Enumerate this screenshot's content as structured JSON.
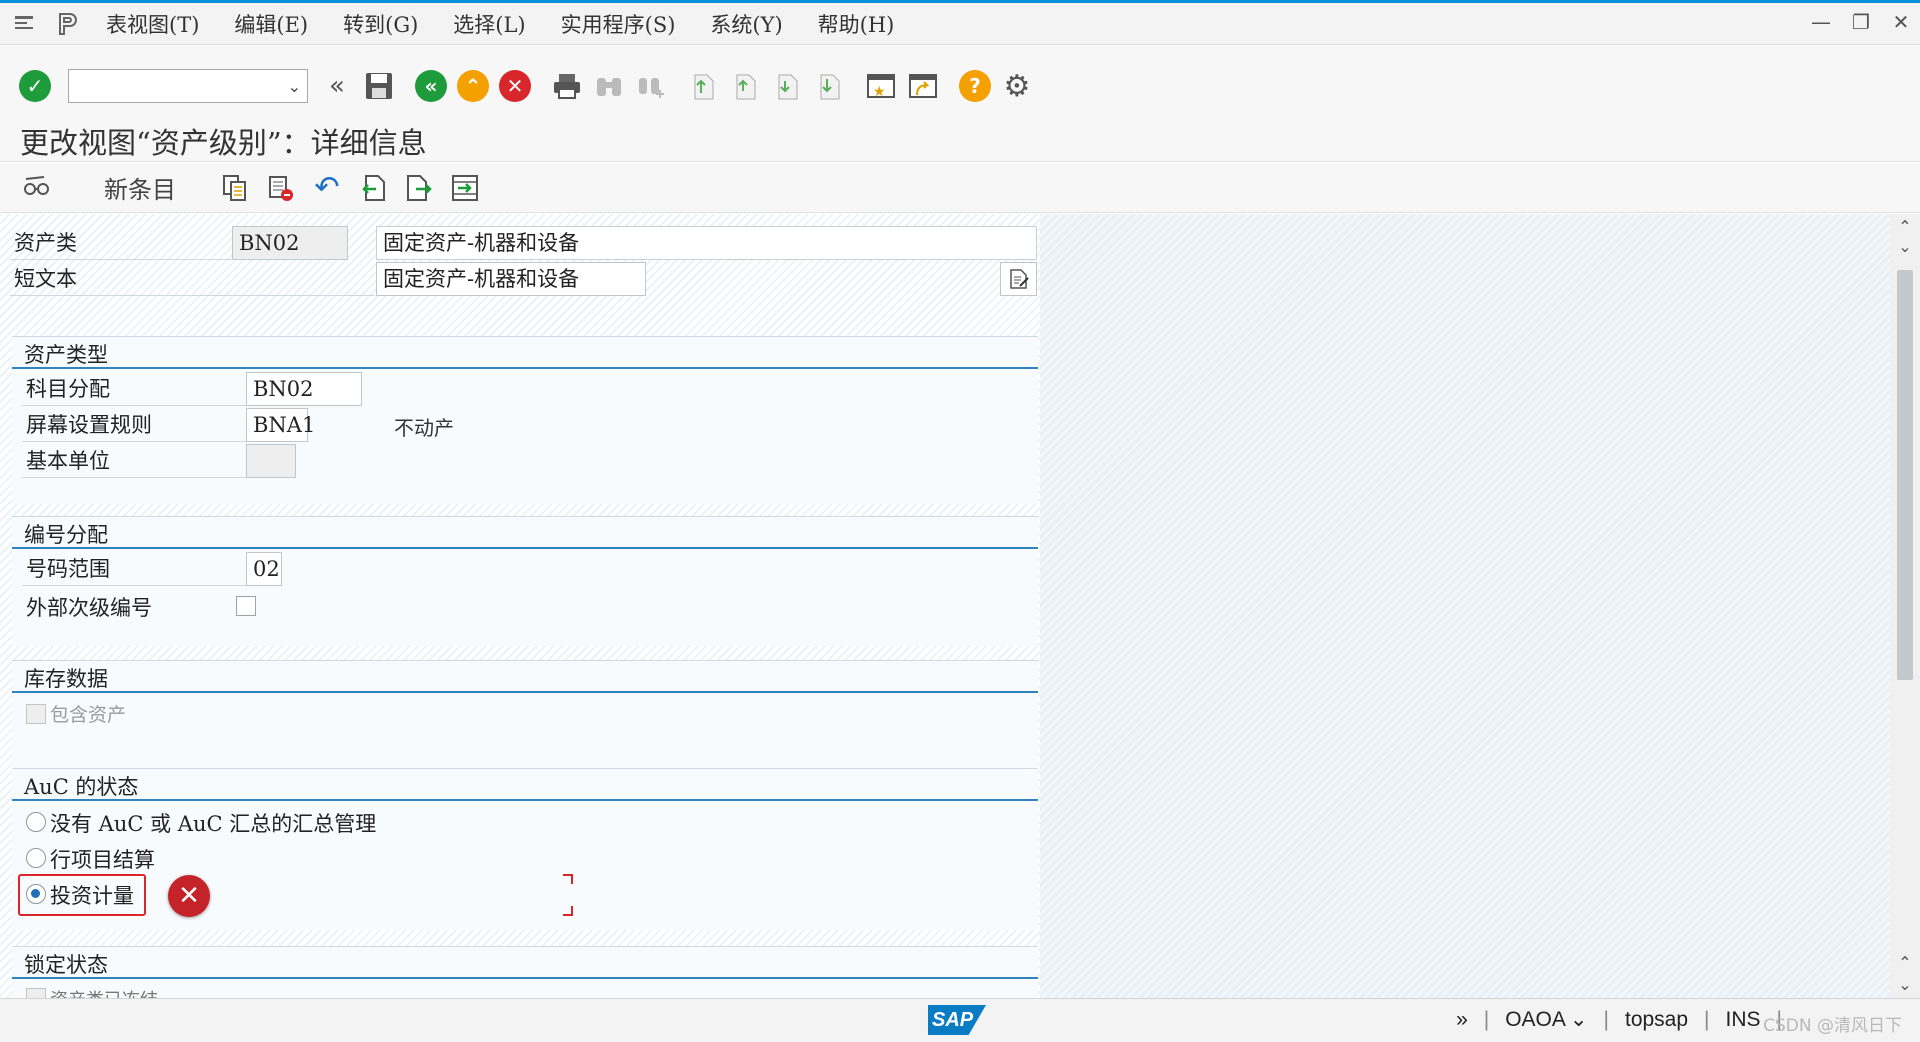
{
  "menu": {
    "items": [
      "表视图(T)",
      "编辑(E)",
      "转到(G)",
      "选择(L)",
      "实用程序(S)",
      "系统(Y)",
      "帮助(H)"
    ]
  },
  "toolbar": {
    "command_value": ""
  },
  "title": "更改视图“资产级别”：详细信息",
  "app_toolbar": {
    "new_entries_label": "新条目"
  },
  "header_fields": {
    "asset_class_label": "资产类",
    "asset_class_value": "BN02",
    "asset_class_desc": "固定资产-机器和设备",
    "short_text_label": "短文本",
    "short_text_value": "固定资产-机器和设备"
  },
  "groups": {
    "asset_type": {
      "title": "资产类型",
      "account_determination_label": "科目分配",
      "account_determination_value": "BN02",
      "screen_layout_label": "屏幕设置规则",
      "screen_layout_value": "BNA1",
      "screen_layout_desc": "不动产",
      "base_unit_label": "基本单位",
      "base_unit_value": ""
    },
    "number_assignment": {
      "title": "编号分配",
      "number_range_label": "号码范围",
      "number_range_value": "02",
      "external_sub_label": "外部次级编号"
    },
    "inventory_data": {
      "title": "库存数据",
      "include_asset_label": "包含资产"
    },
    "auc_status": {
      "title": "AuC 的状态",
      "options": [
        "没有 AuC 或 AuC 汇总的汇总管理",
        "行项目结算",
        "投资计量"
      ],
      "selected_index": 2
    },
    "lock_status": {
      "title": "锁定状态",
      "partial_label": "资产类已冻结"
    }
  },
  "statusbar": {
    "transaction": "OAOA",
    "server": "topsap",
    "mode": "INS",
    "watermark": "CSDN @清风日下"
  },
  "colors": {
    "accent_blue": "#2e86c1",
    "ok_green": "#1e9b3a",
    "cancel_red": "#d8262a",
    "highlight_red": "#d8262a"
  }
}
